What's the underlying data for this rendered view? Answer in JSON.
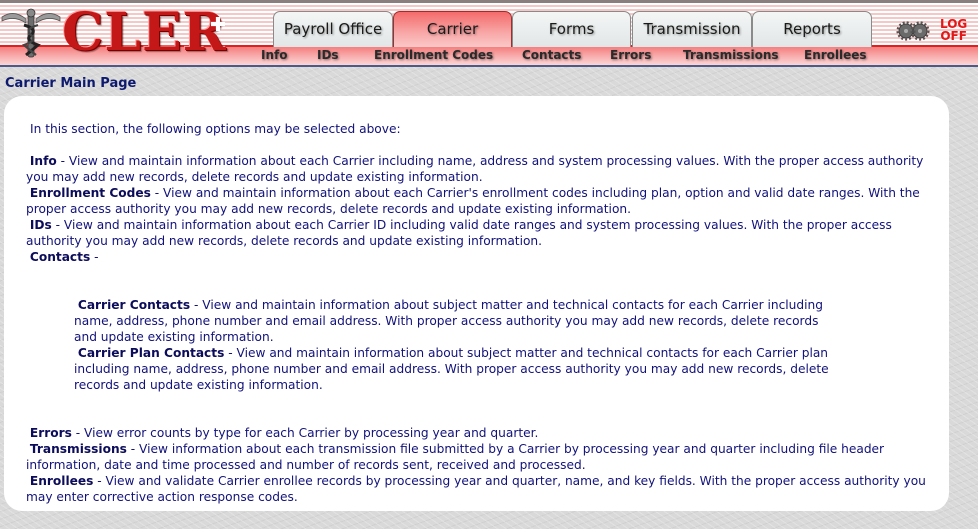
{
  "header": {
    "logo_text": "CLER",
    "tabs": [
      {
        "label": "Payroll Office",
        "active": false
      },
      {
        "label": "Carrier",
        "active": true
      },
      {
        "label": "Forms",
        "active": false
      },
      {
        "label": "Transmission",
        "active": false
      },
      {
        "label": "Reports",
        "active": false
      }
    ],
    "subnav": [
      "Info",
      "IDs",
      "Enrollment Codes",
      "Contacts",
      "Errors",
      "Transmissions",
      "Enrollees"
    ],
    "logoff": {
      "line1": "LOG",
      "line2": "OFF"
    },
    "colors": {
      "brand_red": "#c41818",
      "logoff_red": "#e01818",
      "text_navy": "#12127a"
    }
  },
  "page": {
    "title": "Carrier Main Page",
    "intro": "In this section, the following options may be selected above:",
    "sections": [
      {
        "term": "Info",
        "text": " - View and maintain information about each Carrier including name, address and system processing values.  With the proper access authority you may add new records, delete records and update existing information."
      },
      {
        "term": "Enrollment Codes",
        "text": " - View and maintain information about each Carrier's enrollment codes including plan, option and valid date ranges.  With the proper access authority you may add new records, delete records and update existing information."
      },
      {
        "term": "IDs",
        "text": " - View and maintain information about each Carrier ID including valid date ranges and system processing values.  With the proper access authority you may add new records, delete records and update existing information."
      },
      {
        "term": "Contacts",
        "text": " -"
      }
    ],
    "contacts_sub": [
      {
        "term": "Carrier Contacts",
        "text": " - View and maintain information about subject matter and technical contacts for each Carrier including name, address, phone number and email address.  With proper access authority you may add new records, delete records and update existing information."
      },
      {
        "term": "Carrier Plan Contacts",
        "text": " - View and maintain information about subject matter and technical contacts for each Carrier plan including name, address, phone number and email address.  With proper access authority you may add new records, delete records and update existing information."
      }
    ],
    "sections_after": [
      {
        "term": "Errors",
        "text": " - View error counts by type for each Carrier by processing year and quarter."
      },
      {
        "term": "Transmissions",
        "text": " - View information about each transmission file submitted by a Carrier by processing year and quarter including file header information, date and time processed and number of records sent, received and processed."
      },
      {
        "term": "Enrollees",
        "text": " - View and validate Carrier enrollee records by processing year and quarter, name, and key fields.  With the proper access authority you may enter corrective action response codes."
      }
    ]
  }
}
